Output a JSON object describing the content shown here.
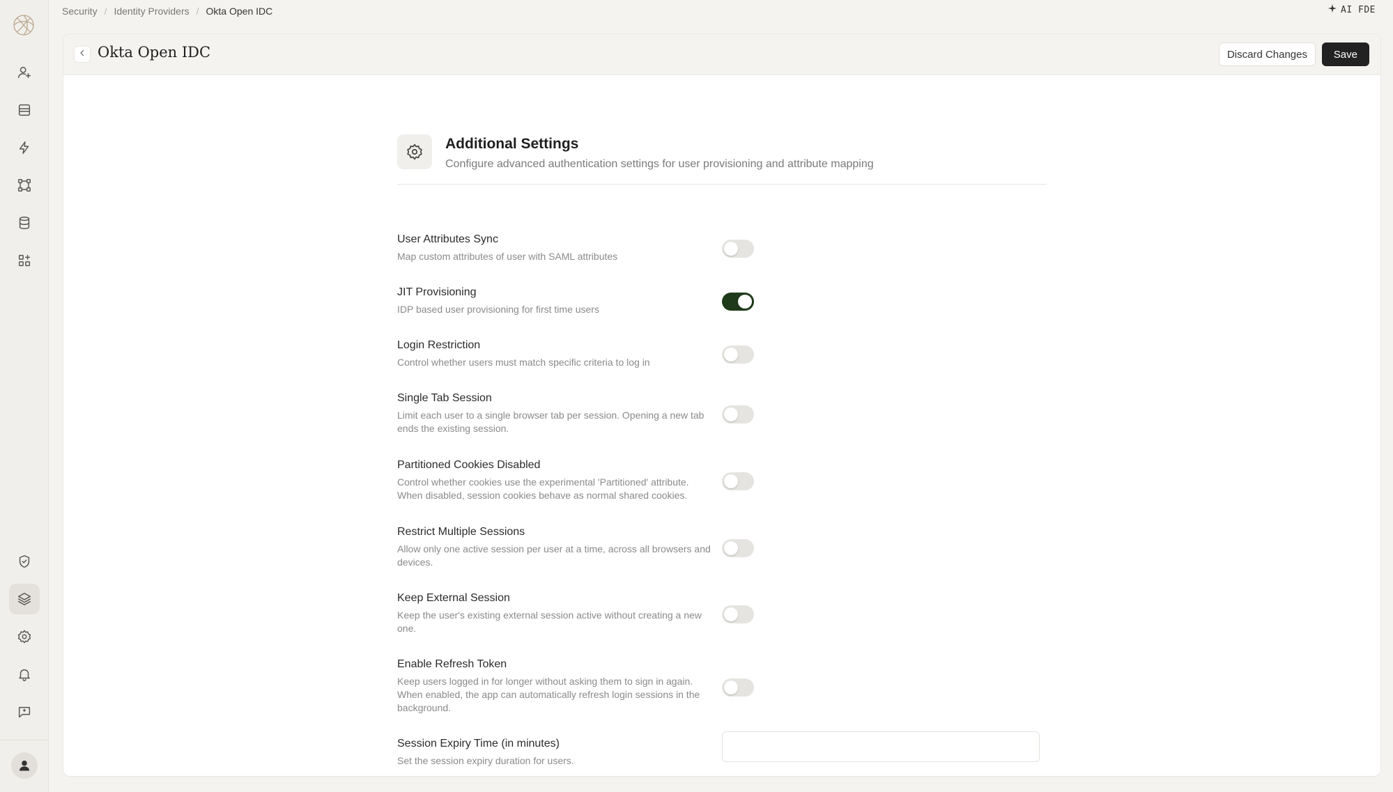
{
  "breadcrumb": {
    "items": [
      "Security",
      "Identity Providers",
      "Okta Open IDC"
    ]
  },
  "top_right": {
    "label": "AI FDE",
    "icon": "sparkle-icon"
  },
  "sidebar": {
    "items": [
      {
        "name": "users-icon"
      },
      {
        "name": "inbox-icon"
      },
      {
        "name": "bolt-icon"
      },
      {
        "name": "workflow-icon"
      },
      {
        "name": "database-icon"
      },
      {
        "name": "apps-icon"
      },
      {
        "name": "shield-icon"
      },
      {
        "name": "layers-icon",
        "active": true
      },
      {
        "name": "gear-icon"
      },
      {
        "name": "bell-icon"
      },
      {
        "name": "feedback-icon"
      }
    ]
  },
  "header": {
    "title": "Okta Open IDC",
    "discard_label": "Discard Changes",
    "save_label": "Save"
  },
  "section": {
    "title": "Additional Settings",
    "subtitle": "Configure advanced authentication settings for user provisioning and attribute mapping"
  },
  "settings": [
    {
      "title": "User Attributes Sync",
      "desc": "Map custom attributes of user with SAML attributes",
      "enabled": false
    },
    {
      "title": "JIT Provisioning",
      "desc": "IDP based user provisioning for first time users",
      "enabled": true
    },
    {
      "title": "Login Restriction",
      "desc": "Control whether users must match specific criteria to log in",
      "enabled": false
    },
    {
      "title": "Single Tab Session",
      "desc": "Limit each user to a single browser tab per session. Opening a new tab ends the existing session.",
      "enabled": false
    },
    {
      "title": "Partitioned Cookies Disabled",
      "desc": "Control whether cookies use the experimental 'Partitioned' attribute. When disabled, session cookies behave as normal shared cookies.",
      "enabled": false
    },
    {
      "title": "Restrict Multiple Sessions",
      "desc": "Allow only one active session per user at a time, across all browsers and devices.",
      "enabled": false
    },
    {
      "title": "Keep External Session",
      "desc": "Keep the user's existing external session active without creating a new one.",
      "enabled": false
    },
    {
      "title": "Enable Refresh Token",
      "desc": "Keep users logged in for longer without asking them to sign in again. When enabled, the app can automatically refresh login sessions in the background.",
      "enabled": false
    }
  ],
  "session_expiry": {
    "title": "Session Expiry Time (in minutes)",
    "desc": "Set the session expiry duration for users.",
    "value": ""
  },
  "colors": {
    "toggle_on": "#1f3a1a",
    "toggle_off": "#e6e4e0",
    "primary_button": "#222222"
  }
}
